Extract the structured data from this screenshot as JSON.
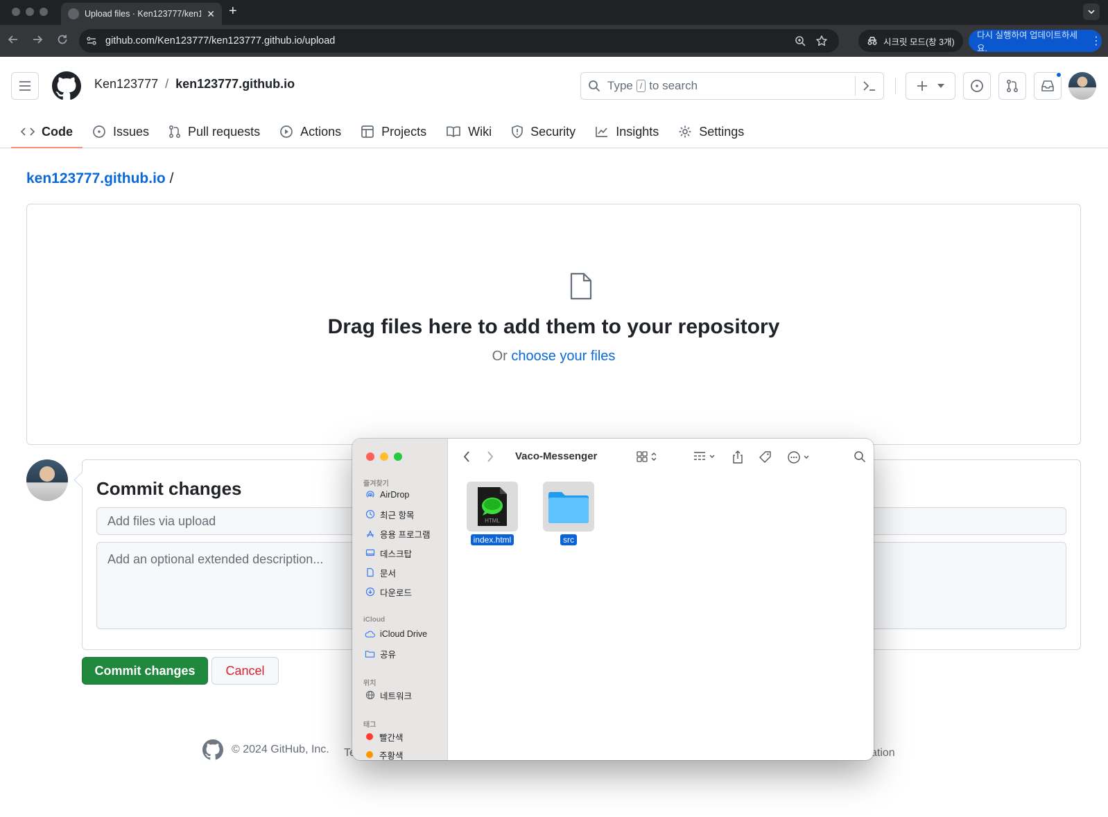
{
  "browser": {
    "tab_title": "Upload files · Ken123777/ken123777.github.io",
    "url": "github.com/Ken123777/ken123777.github.io/upload",
    "incognito_label": "시크릿 모드(창 3개)",
    "update_label": "다시 실행하여 업데이트하세요."
  },
  "header": {
    "owner": "Ken123777",
    "separator": "/",
    "repo": "ken123777.github.io",
    "search_prefix": "Type",
    "search_key": "/",
    "search_suffix": "to search"
  },
  "repo_tabs": [
    {
      "label": "Code",
      "icon": "code-icon",
      "active": true
    },
    {
      "label": "Issues",
      "icon": "issue-icon"
    },
    {
      "label": "Pull requests",
      "icon": "pull-request-icon"
    },
    {
      "label": "Actions",
      "icon": "play-icon"
    },
    {
      "label": "Projects",
      "icon": "table-icon"
    },
    {
      "label": "Wiki",
      "icon": "book-icon"
    },
    {
      "label": "Security",
      "icon": "shield-icon"
    },
    {
      "label": "Insights",
      "icon": "graph-icon"
    },
    {
      "label": "Settings",
      "icon": "gear-icon"
    }
  ],
  "page": {
    "breadcrumb_repo": "ken123777.github.io",
    "breadcrumb_sep": "/",
    "drop_title": "Drag files here to add them to your repository",
    "drop_or": "Or",
    "drop_link": "choose your files",
    "commit_title": "Commit changes",
    "commit_summary_placeholder": "Add files via upload",
    "commit_description_placeholder": "Add an optional extended description...",
    "commit_button": "Commit changes",
    "cancel_button": "Cancel",
    "footer_copyright": "© 2024 GitHub, Inc.",
    "footer_clipped_left": "Te",
    "footer_clipped_right": "ation"
  },
  "finder": {
    "title": "Vaco-Messenger",
    "sections": {
      "favorites": "즐겨찾기",
      "icloud": "iCloud",
      "locations": "위치",
      "tags": "태그"
    },
    "favorites": [
      {
        "label": "AirDrop",
        "icon": "airdrop-icon"
      },
      {
        "label": "최근 항목",
        "icon": "clock-icon"
      },
      {
        "label": "응용 프로그램",
        "icon": "apps-icon"
      },
      {
        "label": "데스크탑",
        "icon": "desktop-icon"
      },
      {
        "label": "문서",
        "icon": "document-icon"
      },
      {
        "label": "다운로드",
        "icon": "download-icon"
      }
    ],
    "icloud": [
      {
        "label": "iCloud Drive",
        "icon": "cloud-icon"
      },
      {
        "label": "공유",
        "icon": "shared-folder-icon"
      }
    ],
    "locations": [
      {
        "label": "네트워크",
        "icon": "globe-icon"
      }
    ],
    "tags": [
      {
        "label": "빨간색",
        "color": "#ff3b30"
      },
      {
        "label": "주황색",
        "color": "#ff9500"
      }
    ],
    "files": [
      {
        "name": "index.html",
        "kind": "html-file"
      },
      {
        "name": "src",
        "kind": "folder"
      }
    ],
    "html_badge": "HTML"
  }
}
